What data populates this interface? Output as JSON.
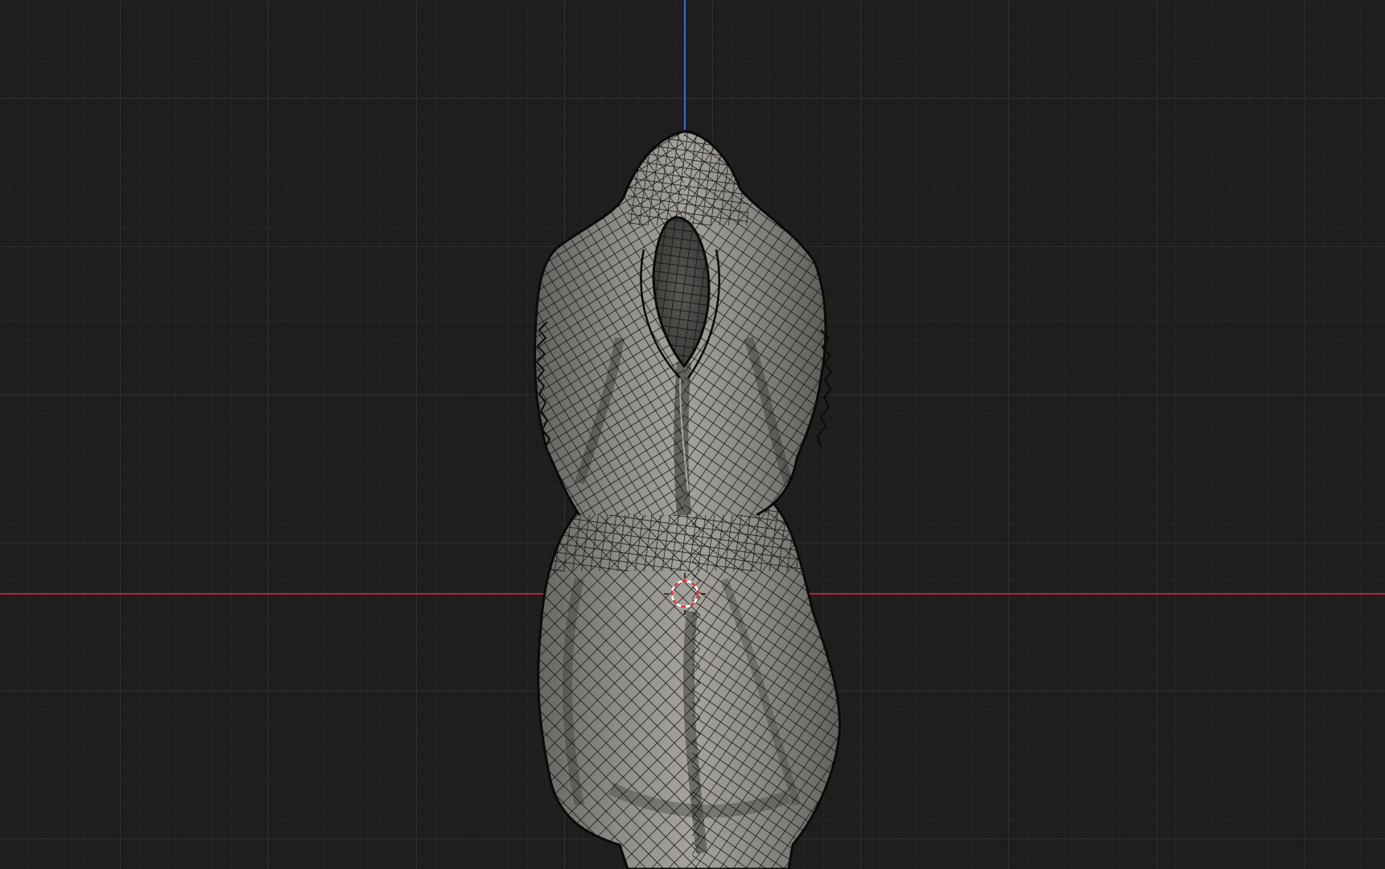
{
  "viewport": {
    "view": "front-orthographic",
    "shading": "solid-with-wireframe-overlay",
    "grid": true,
    "axes": [
      "x-axis",
      "z-axis"
    ],
    "colors": {
      "background": "#1e1e1e",
      "grid_minor": "#2a2a2a",
      "grid_major": "#383838",
      "x_axis": "#b2283a",
      "z_axis": "#3a6ec8",
      "mesh_fill": "#8c8a86",
      "mesh_shadow": "#4a4946",
      "wire": "#0c0c0c",
      "cursor_red": "#e03030",
      "cursor_white": "#ffffff"
    }
  },
  "scene": {
    "object": "draped-cloth-mesh",
    "cursor": "3d-cursor"
  }
}
